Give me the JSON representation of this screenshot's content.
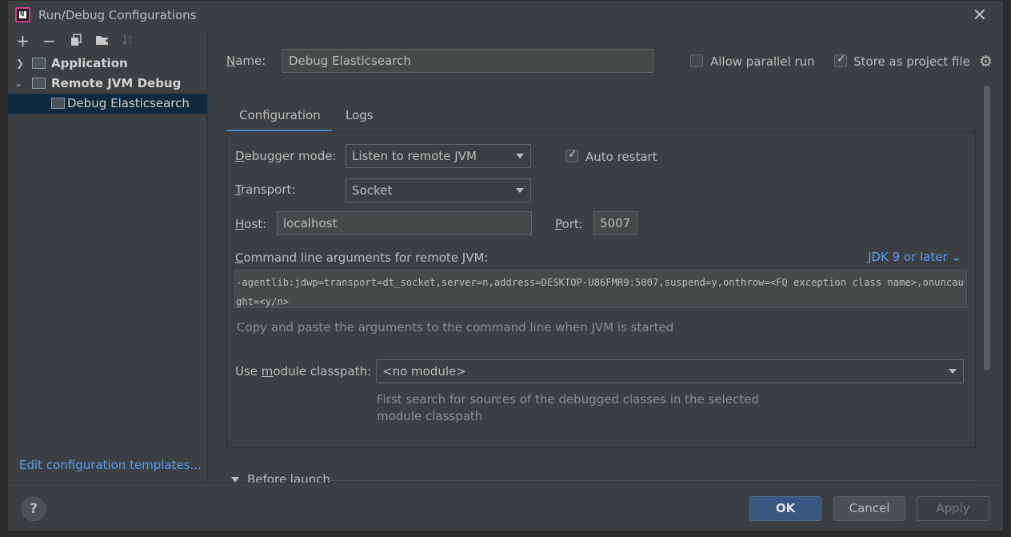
{
  "dialog": {
    "title": "Run/Debug Configurations"
  },
  "left": {
    "toolbar": [
      "+",
      "−",
      "copy",
      "folder",
      "sort"
    ],
    "tree": [
      {
        "label": "Application",
        "expanded": false,
        "bold": true
      },
      {
        "label": "Remote JVM Debug",
        "expanded": true,
        "bold": true
      },
      {
        "label": "Debug Elasticsearch",
        "selected": true
      }
    ],
    "edit_templates": "Edit configuration templates..."
  },
  "form": {
    "name_label": "Name:",
    "name_value": "Debug Elasticsearch",
    "allow_parallel_label": "Allow parallel run",
    "allow_parallel_checked": false,
    "store_label": "Store as project file",
    "store_checked": true,
    "tabs": [
      "Configuration",
      "Logs"
    ],
    "debugger_mode_label": "Debugger mode:",
    "debugger_mode_value": "Listen to remote JVM",
    "auto_restart_label": "Auto restart",
    "auto_restart_checked": true,
    "transport_label": "Transport:",
    "transport_value": "Socket",
    "host_label": "Host:",
    "host_value": "localhost",
    "port_label": "Port:",
    "port_value": "5007",
    "cmd_label": "Command line arguments for remote JVM:",
    "jdk_link": "JDK 9 or later",
    "cmd_value": "-agentlib:jdwp=transport=dt_socket,server=n,address=DESKTOP-U86FMR9:5007,suspend=y,onthrow=<FQ exception class name>,onuncaught=<y/n>",
    "cmd_hint": "Copy and paste the arguments to the command line when JVM is started",
    "module_label": "Use module classpath:",
    "module_value": "<no module>",
    "module_hint_line1": "First search for sources of the debugged classes in the selected",
    "module_hint_line2": "module classpath",
    "before_launch": "Before launch"
  },
  "footer": {
    "help": "?",
    "ok": "OK",
    "cancel": "Cancel",
    "apply": "Apply"
  },
  "colors": {
    "background": "#3c3f41",
    "link": "#589df6",
    "ok_button": "#365880",
    "selection": "#0d293e",
    "tab_underline": "#4a88c7"
  }
}
